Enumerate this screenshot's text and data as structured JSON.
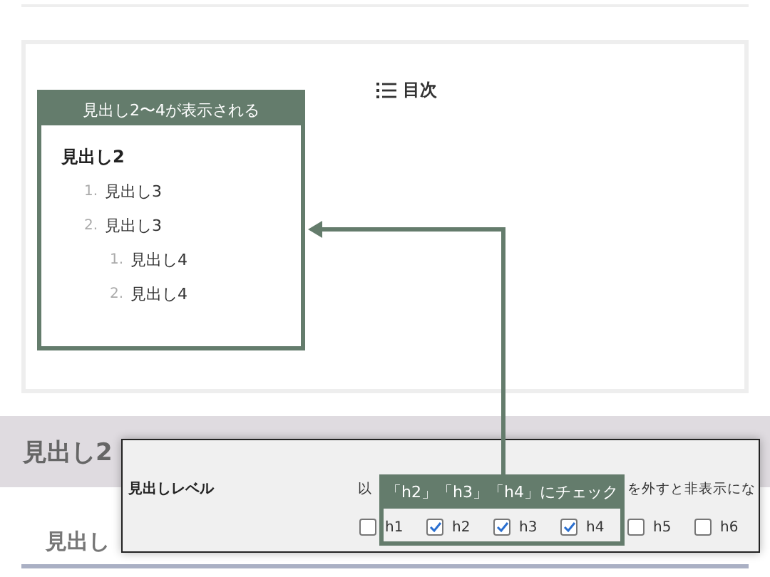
{
  "toc": {
    "title": "目次",
    "annotation": "見出し2〜4が表示される",
    "heading": "見出し2",
    "items": [
      {
        "number": "1.",
        "label": "見出し3"
      },
      {
        "number": "2.",
        "label": "見出し3",
        "children": [
          {
            "number": "1.",
            "label": "見出し4"
          },
          {
            "number": "2.",
            "label": "見出し4"
          }
        ]
      }
    ]
  },
  "article": {
    "heading_2": "見出し2",
    "heading_3": "見出し"
  },
  "settings_panel": {
    "label": "見出しレベル",
    "description_left": "以",
    "description_right": "を外すと非表示にな",
    "annotation": "「h2」「h3」「h4」にチェック",
    "levels": [
      {
        "label": "h1",
        "checked": false
      },
      {
        "label": "h2",
        "checked": true
      },
      {
        "label": "h3",
        "checked": true
      },
      {
        "label": "h4",
        "checked": true
      },
      {
        "label": "h5",
        "checked": false
      },
      {
        "label": "h6",
        "checked": false
      }
    ]
  }
}
